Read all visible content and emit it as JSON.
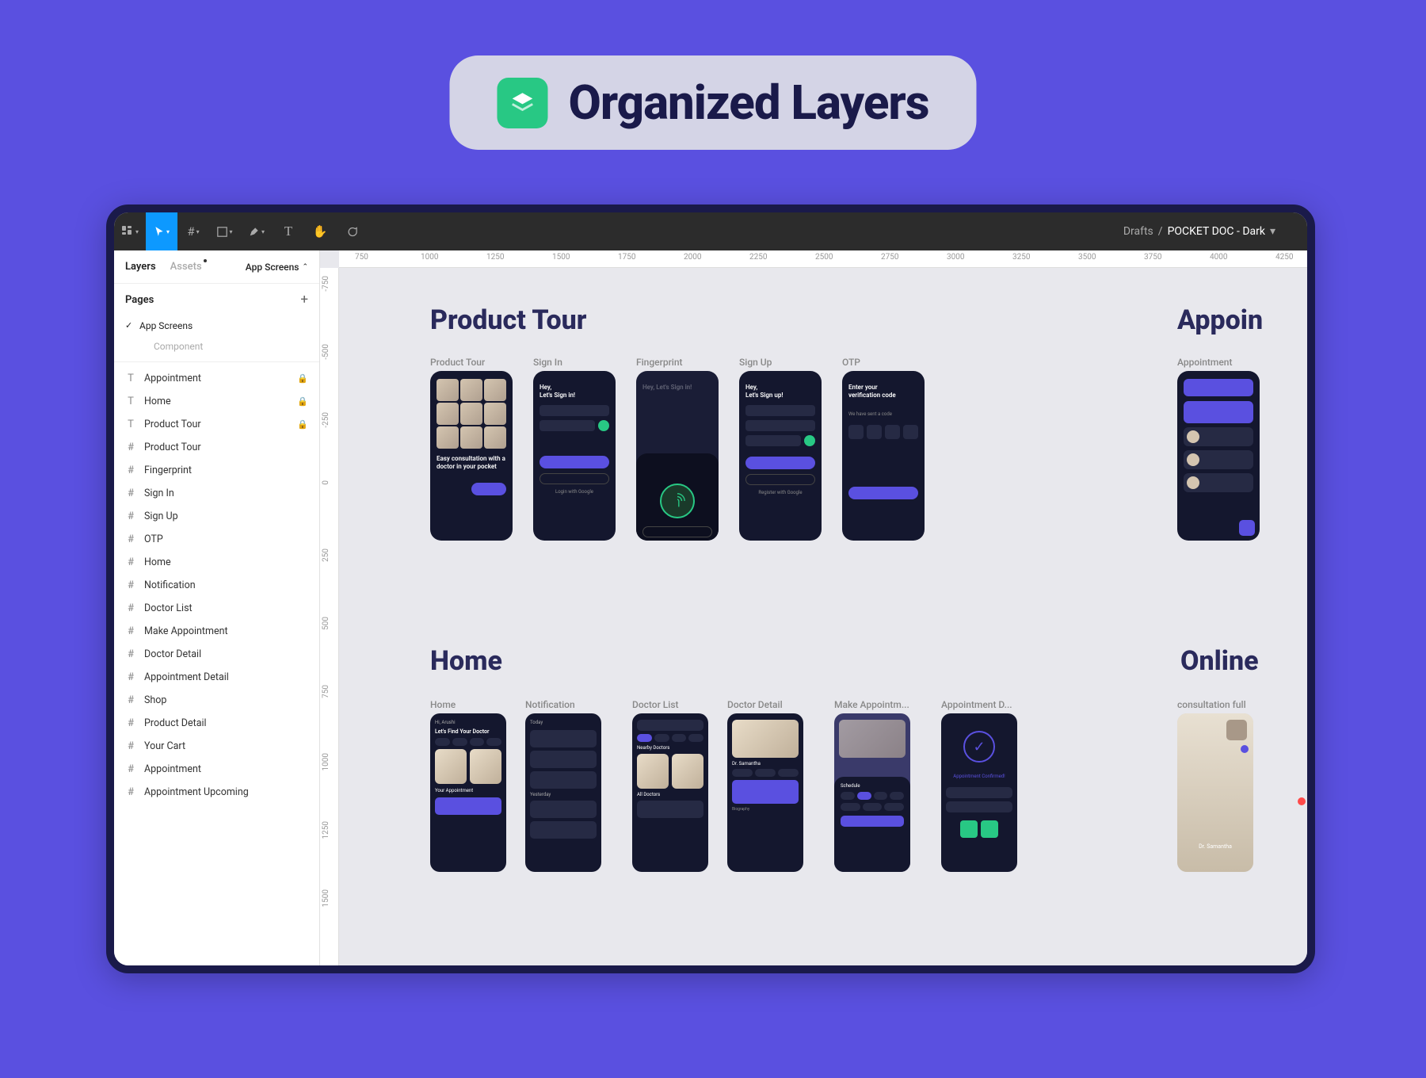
{
  "badge": {
    "title": "Organized Layers"
  },
  "toolbar": {
    "breadcrumb": {
      "drafts": "Drafts",
      "file": "POCKET DOC - Dark"
    }
  },
  "leftPanel": {
    "tabs": {
      "layers": "Layers",
      "assets": "Assets",
      "pageSelector": "App Screens"
    },
    "pages": {
      "header": "Pages",
      "current": "App Screens",
      "other": "Component"
    },
    "layers": [
      {
        "icon": "T",
        "label": "Appointment",
        "locked": true
      },
      {
        "icon": "T",
        "label": "Home",
        "locked": true
      },
      {
        "icon": "T",
        "label": "Product Tour",
        "locked": true
      },
      {
        "icon": "#",
        "label": "Product Tour"
      },
      {
        "icon": "#",
        "label": "Fingerprint"
      },
      {
        "icon": "#",
        "label": "Sign In"
      },
      {
        "icon": "#",
        "label": "Sign Up"
      },
      {
        "icon": "#",
        "label": "OTP"
      },
      {
        "icon": "#",
        "label": "Home"
      },
      {
        "icon": "#",
        "label": "Notification"
      },
      {
        "icon": "#",
        "label": "Doctor List"
      },
      {
        "icon": "#",
        "label": "Make Appointment"
      },
      {
        "icon": "#",
        "label": "Doctor Detail"
      },
      {
        "icon": "#",
        "label": "Appointment Detail"
      },
      {
        "icon": "#",
        "label": "Shop"
      },
      {
        "icon": "#",
        "label": "Product Detail"
      },
      {
        "icon": "#",
        "label": "Your Cart"
      },
      {
        "icon": "#",
        "label": "Appointment"
      },
      {
        "icon": "#",
        "label": "Appointment Upcoming"
      }
    ]
  },
  "ruler": {
    "h": [
      "750",
      "1000",
      "1250",
      "1500",
      "1750",
      "2000",
      "2250",
      "2500",
      "2750",
      "3000",
      "3250",
      "3500",
      "3750",
      "4000",
      "4250"
    ],
    "v": [
      "-750",
      "-500",
      "-250",
      "0",
      "250",
      "500",
      "750",
      "1000",
      "1250",
      "1500"
    ]
  },
  "canvas": {
    "sections": {
      "productTour": "Product Tour",
      "appoin": "Appoin",
      "home": "Home",
      "online": "Online"
    },
    "frameLabels": {
      "productTour": "Product Tour",
      "signIn": "Sign In",
      "fingerprint": "Fingerprint",
      "signUp": "Sign Up",
      "otp": "OTP",
      "appointment": "Appointment",
      "home": "Home",
      "notification": "Notification",
      "doctorList": "Doctor List",
      "doctorDetail": "Doctor Detail",
      "makeAppt": "Make Appointm...",
      "apptDetail": "Appointment D...",
      "consultFull": "consultation full"
    },
    "phoneText": {
      "signInHead": "Hey,\nLet's Sign in!",
      "signUpHead": "Hey,\nLet's Sign up!",
      "otpHead": "Enter your\nverification code",
      "tourText": "Easy consultation with a doctor in your pocket",
      "loginGoogle": "Login with Google",
      "registerGoogle": "Register with Google",
      "apptConfirmed": "Appointment Confirmed!",
      "nearbyDoctors": "Nearby Doctors",
      "allDoctors": "All Doctors",
      "findDoctor": "Let's Find Your Doctor",
      "yourAppt": "Your Appointment",
      "today": "Today",
      "yesterday": "Yesterday",
      "drSamantha": "Dr. Samantha"
    }
  }
}
